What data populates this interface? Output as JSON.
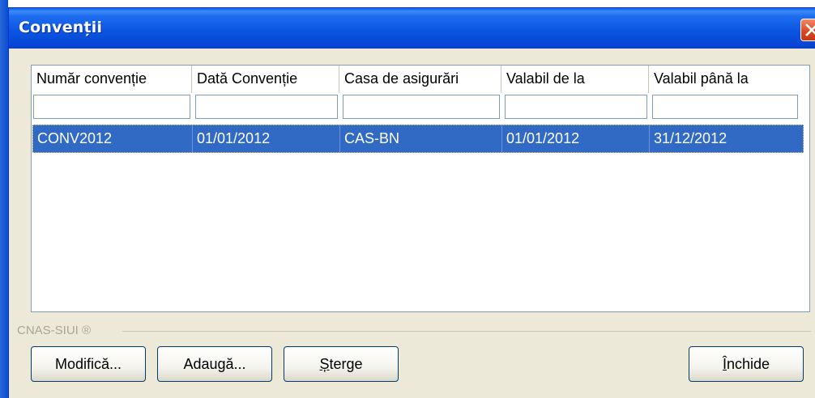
{
  "window": {
    "title": "Convenții"
  },
  "table": {
    "columns": [
      "Număr convenție",
      "Dată Convenție",
      "Casa de asigurări",
      "Valabil de la",
      "Valabil până la"
    ],
    "rows": [
      [
        "CONV2012",
        "01/01/2012",
        "CAS-BN",
        "01/01/2012",
        "31/12/2012"
      ]
    ],
    "filters": [
      "",
      "",
      "",
      "",
      ""
    ]
  },
  "footer": {
    "group_label": "CNAS-SIUI ®"
  },
  "buttons": {
    "modify": "Modifică...",
    "add": "Adaugă...",
    "delete_first": "Ș",
    "delete_rest": "terge",
    "close_first": "Î",
    "close_rest": "nchide"
  },
  "icons": {
    "close": "close-x-icon"
  },
  "colors": {
    "title_bar": "#0a54e0",
    "selection": "#316ac5",
    "window_bg": "#ece9d8",
    "close_button": "#d9451f"
  }
}
